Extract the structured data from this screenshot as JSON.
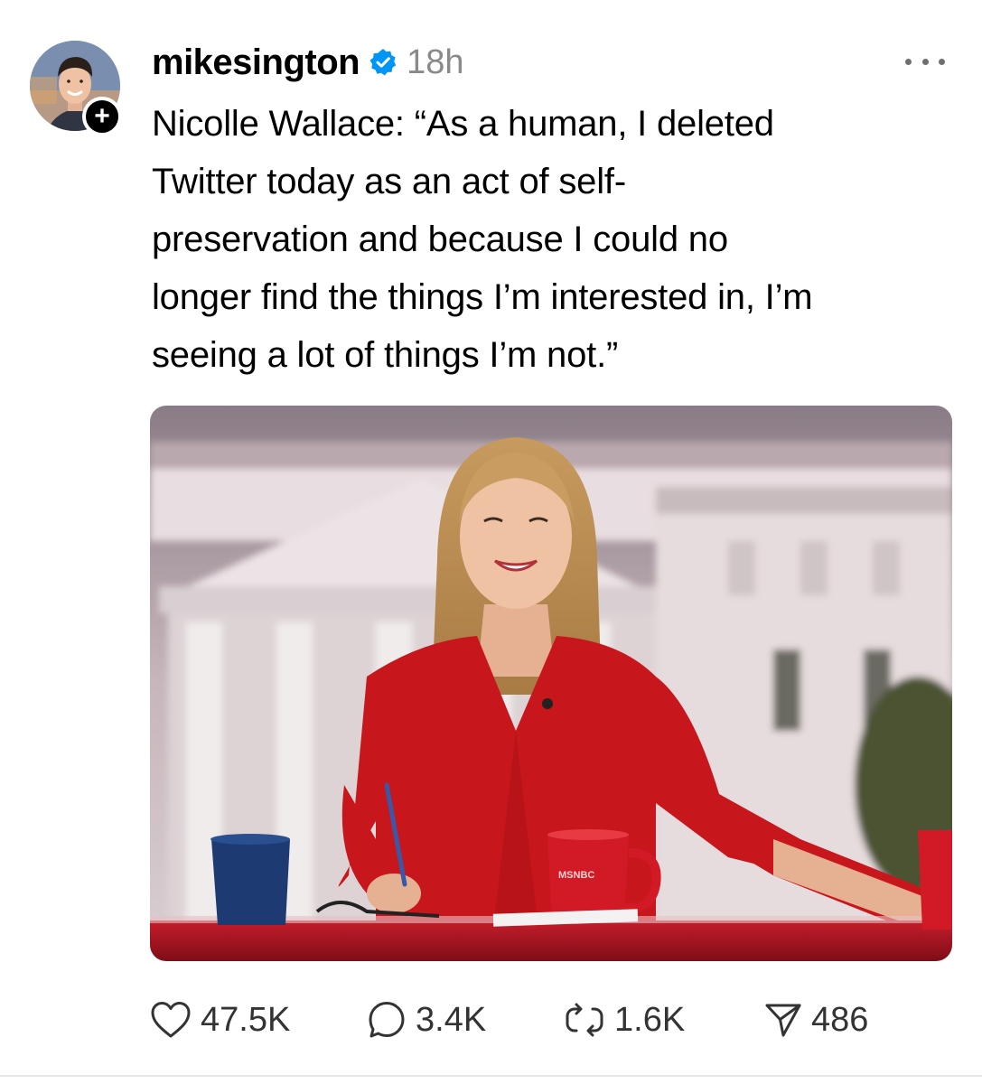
{
  "post": {
    "username": "mikesington",
    "timestamp": "18h",
    "verified": true,
    "follow_symbol": "+",
    "text": "Nicolle Wallace: “As a human, I deleted\nTwitter today as an act of self-\npreservation and because I could no\nlonger find the things I’m interested in, I’m\nseeing a lot of things I’m not.”",
    "media": {
      "mug_text": "MSNBC"
    }
  },
  "actions": {
    "likes": "47.5K",
    "replies": "3.4K",
    "reposts": "1.6K",
    "shares": "486"
  },
  "icons": {
    "like": "heart-icon",
    "reply": "comment-icon",
    "repost": "repost-icon",
    "share": "send-icon",
    "more": "more-dots-icon",
    "verified": "verified-badge-icon",
    "follow": "plus-icon"
  },
  "colors": {
    "verified_blue": "#0095f6",
    "timestamp_gray": "#8a8a8a",
    "text": "#000000",
    "dress_red": "#c8161d"
  }
}
